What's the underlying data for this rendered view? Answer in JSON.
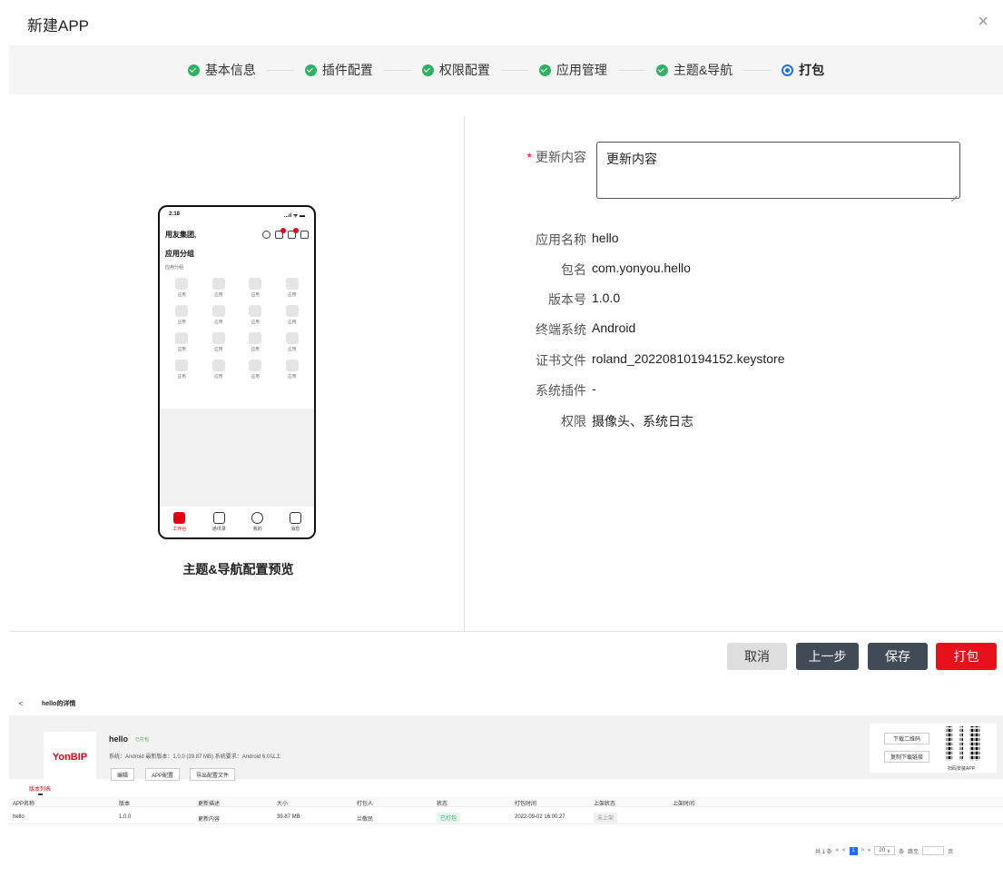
{
  "dialog": {
    "title": "新建APP",
    "close_glyph": "×"
  },
  "steps": [
    {
      "label": "基本信息",
      "state": "done"
    },
    {
      "label": "插件配置",
      "state": "done"
    },
    {
      "label": "权限配置",
      "state": "done"
    },
    {
      "label": "应用管理",
      "state": "done"
    },
    {
      "label": "主题&导航",
      "state": "done"
    },
    {
      "label": "打包",
      "state": "current"
    }
  ],
  "preview": {
    "caption": "主题&导航配置预览",
    "status_time": "2:18",
    "status_signal": "...ıl ᯤ ▬",
    "company": "用友集团,",
    "group_title": "应用分组",
    "group_sub": "应用分组",
    "app_label": "应用",
    "tabs": [
      {
        "label": "工作台",
        "active": true
      },
      {
        "label": "通讯录",
        "active": false
      },
      {
        "label": "我的",
        "active": false
      },
      {
        "label": "消息",
        "active": false
      }
    ]
  },
  "form": {
    "update_label": "更新内容",
    "update_value": "更新内容",
    "fields": [
      {
        "label": "应用名称",
        "value": "hello"
      },
      {
        "label": "包名",
        "value": "com.yonyou.hello"
      },
      {
        "label": "版本号",
        "value": "1.0.0"
      },
      {
        "label": "终端系统",
        "value": "Android"
      },
      {
        "label": "证书文件",
        "value": "roland_20220810194152.keystore"
      },
      {
        "label": "系统插件",
        "value": "-"
      },
      {
        "label": "权限",
        "value": "摄像头、系统日志"
      }
    ]
  },
  "buttons": {
    "cancel": "取消",
    "prev": "上一步",
    "save": "保存",
    "pack": "打包"
  },
  "detail": {
    "back_glyph": "<",
    "title": "hello的详情",
    "logo_text": "YonBIP",
    "app_name": "hello",
    "status_tag": "已打包",
    "meta": "系统：Android    最新版本：1.0.0  (39.87 MB)    系统要求：Android 6.0以上",
    "btn_edit": "编辑",
    "btn_config": "APP配置",
    "btn_export": "导出配置文件",
    "btn_download_qr": "下载二维码",
    "btn_copy_link": "复制下载链接",
    "qr_caption": "扫码安装APP",
    "tab_versions": "版本列表",
    "columns": [
      "APP名称",
      "版本",
      "更新描述",
      "大小",
      "打包人",
      "状态",
      "打包时间",
      "上架状态",
      "上架时间"
    ],
    "row": [
      "hello",
      "1.0.0",
      "更新内容",
      "39.87 MB",
      "兰敬民",
      "已打包",
      "2022-09-02 16:00:27",
      "未上架",
      ""
    ],
    "pager": {
      "total": "共 1 条",
      "first": "«",
      "prev": "<",
      "page": "1",
      "next": ">",
      "last": "»",
      "size": "20",
      "size_arrow": "∨",
      "unit": "条",
      "jump": "跳至",
      "page_unit": "页"
    }
  }
}
